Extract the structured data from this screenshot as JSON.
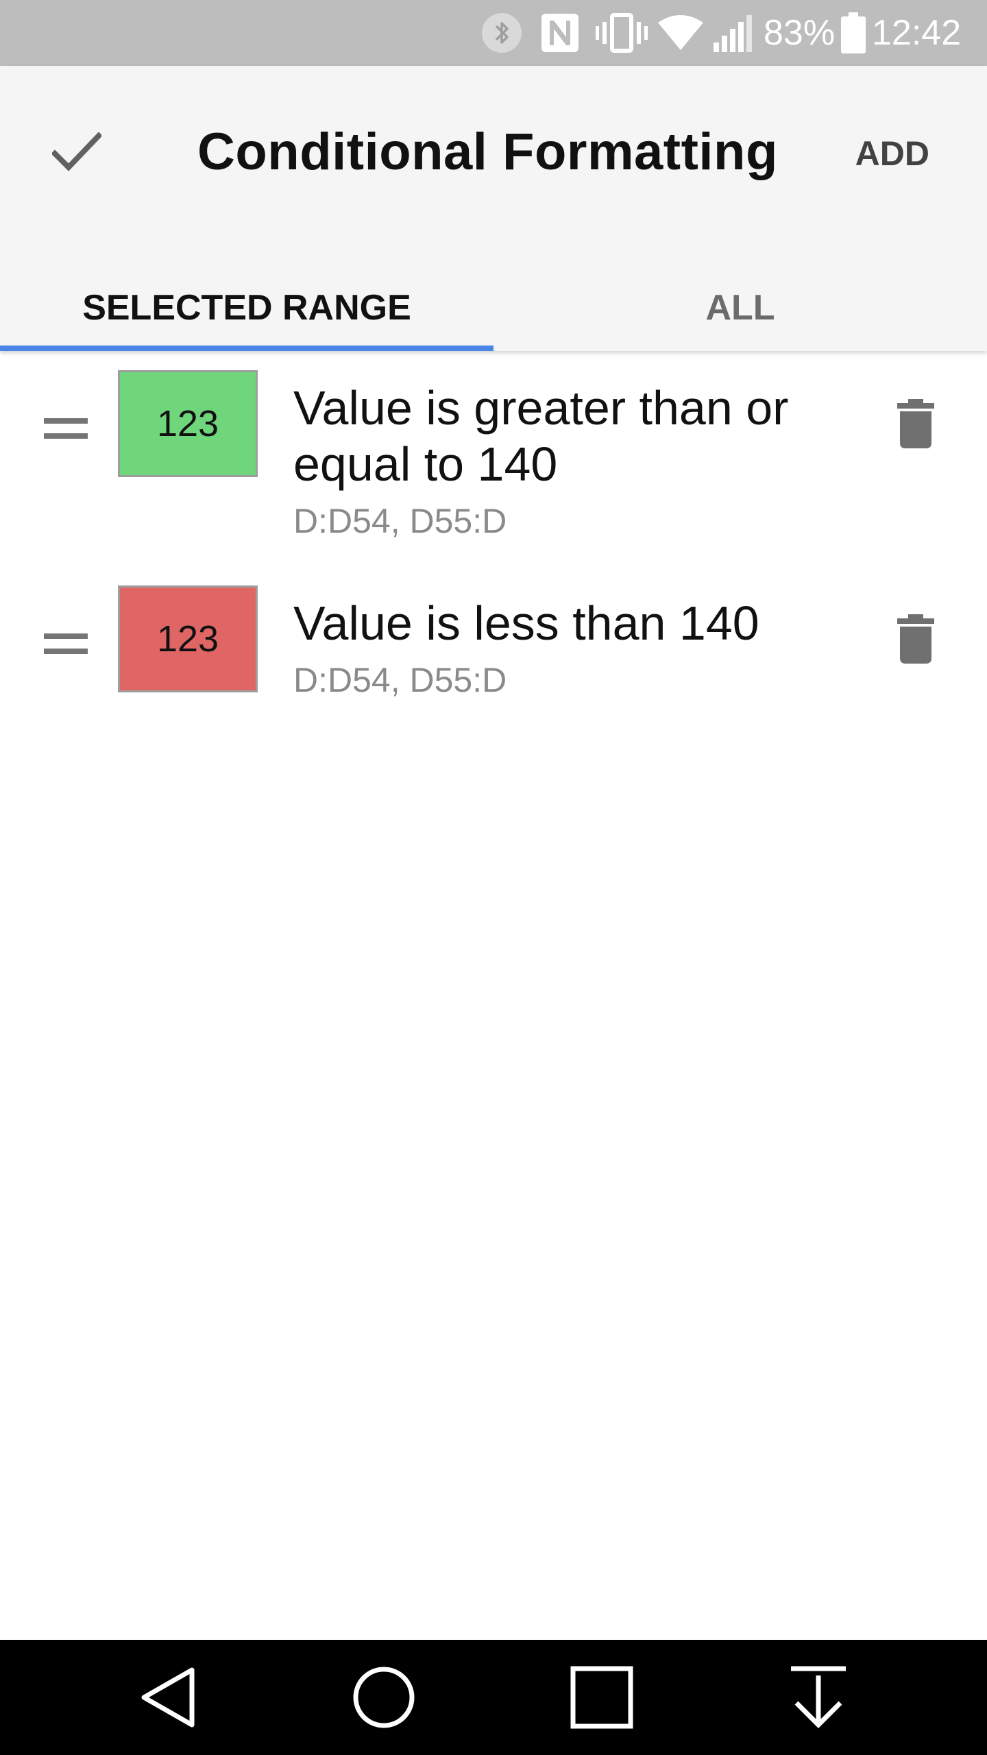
{
  "status_bar": {
    "battery_percent": "83%",
    "time": "12:42",
    "icons": [
      "bluetooth-icon",
      "nfc-icon",
      "vibrate-icon",
      "wifi-icon",
      "signal-icon",
      "battery-icon"
    ]
  },
  "app_bar": {
    "title": "Conditional Formatting",
    "done_icon": "check-icon",
    "add_label": "ADD"
  },
  "tabs": [
    {
      "label": "SELECTED RANGE",
      "active": true
    },
    {
      "label": "ALL",
      "active": false
    }
  ],
  "colors": {
    "accent": "#4a86e8",
    "rule_green": "#6fd67c",
    "rule_red": "#e06666"
  },
  "rules": [
    {
      "swatch_text": "123",
      "swatch_color": "#6fd67c",
      "title": "Value is greater than or equal to 140",
      "range": "D:D54, D55:D"
    },
    {
      "swatch_text": "123",
      "swatch_color": "#e06666",
      "title": "Value is less than 140",
      "range": "D:D54, D55:D"
    }
  ],
  "nav_bar": {
    "icons": [
      "back-icon",
      "home-icon",
      "recents-icon",
      "notification-pull-icon"
    ]
  }
}
